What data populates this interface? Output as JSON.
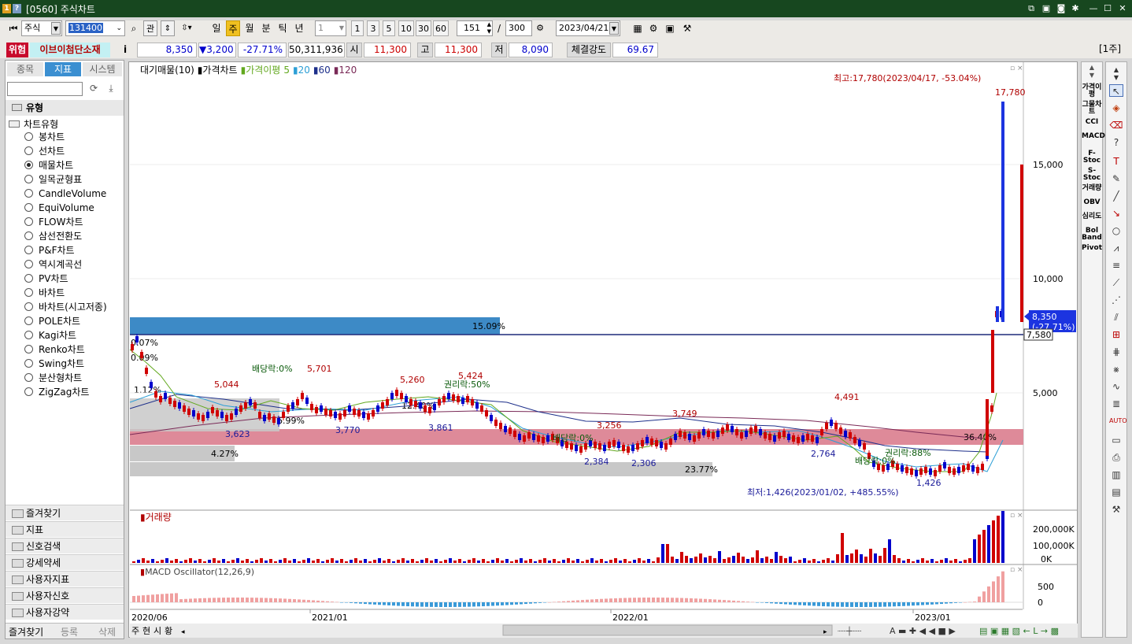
{
  "window": {
    "title": "[0560] 주식차트",
    "icons": [
      "window-icon",
      "help-icon"
    ]
  },
  "toolbar": {
    "market": "주식",
    "code": "131400",
    "btn_gwan": "관",
    "period_buttons": [
      "일",
      "주",
      "월",
      "분",
      "틱",
      "년"
    ],
    "active_period": "주",
    "interval_value": "1",
    "interval_buttons": [
      "1",
      "3",
      "5",
      "10",
      "30",
      "60"
    ],
    "count": "151",
    "total": "300",
    "date": "2023/04/21",
    "slash": "/"
  },
  "info": {
    "warning": "위험",
    "name": "이브이첨단소재",
    "i": "i",
    "price": "8,350",
    "change": "▼3,200",
    "change_pct": "-27.71%",
    "volume": "50,311,936",
    "open_label": "시",
    "open": "11,300",
    "high_label": "고",
    "high": "11,300",
    "low_label": "저",
    "low": "8,090",
    "strength_label": "체결강도",
    "strength": "69.67",
    "unit": "[1주]",
    "colors": {
      "down": "#0000cc",
      "up": "#cc0000"
    }
  },
  "left": {
    "tabs": [
      "종목",
      "지표",
      "시스템"
    ],
    "active_tab": "지표",
    "section": "유형",
    "group": "차트유형",
    "types": [
      "봉차트",
      "선차트",
      "매물차트",
      "일목균형표",
      "CandleVolume",
      "EquiVolume",
      "FLOW차트",
      "삼선전환도",
      "P&F차트",
      "역시계곡선",
      "PV차트",
      "바차트",
      "바차트(시고저종)",
      "POLE차트",
      "Kagi차트",
      "Renko차트",
      "Swing차트",
      "분산형차트",
      "ZigZag차트"
    ],
    "selected_type": "매물차트",
    "folders": [
      "즐겨찾기",
      "지표",
      "신호검색",
      "강세약세",
      "사용자지표",
      "사용자신호",
      "사용자강약"
    ],
    "bottom": [
      "즐겨찾기",
      "등록",
      "삭제"
    ]
  },
  "price_legend": {
    "a": "대기매물(10)",
    "b": "가격차트",
    "c": "가격이평",
    "n5": "5",
    "n20": "20",
    "n60": "60",
    "n120": "120"
  },
  "price_axis": [
    "15,000",
    "10,000",
    "5,000"
  ],
  "annotations": {
    "max": "최고:17,780(2023/04/17, -53.04%)",
    "min": "최저:1,426(2023/01/02, +485.55%)",
    "max_val": "17,780",
    "min_val": "1,426",
    "cur_price": "8,350",
    "cur_pct": "(-27.71%)",
    "line_val": "7,580",
    "div1": "배당락:0%",
    "div2": "배당락:0%",
    "div3": "배당락:0%",
    "rights1": "권리락:50%",
    "rights2": "권리락:88%",
    "h1": "5,044",
    "h2": "5,701",
    "h3": "5,260",
    "h4": "5,424",
    "h5": "3,256",
    "h6": "3,749",
    "h7": "4,491",
    "l1": "3,623",
    "l2": "3,770",
    "l3": "3,861",
    "l4": "2,384",
    "l5": "2,306",
    "l6": "2,764",
    "l7": "1,426",
    "vp1": "15.09%",
    "vp2": "36.40%",
    "vp3": "4.27%",
    "vp4": "23.77%",
    "vp5": "1.12%",
    "vp6": "6.99%",
    "vp7": "0.07%",
    "vp8": "0.09%",
    "vp9": "12.40%"
  },
  "volume": {
    "title": "거래량",
    "axis": [
      "200,000K",
      "100,000K",
      "0K"
    ]
  },
  "macd": {
    "title": "MACD Oscillator(12,26,9)",
    "axis": [
      "500",
      "0"
    ]
  },
  "xaxis": [
    "2020/06",
    "2021/01",
    "2022/01",
    "2023/01"
  ],
  "bottom_tabs": [
    "주",
    "현",
    "시",
    "황"
  ],
  "right_tools": [
    "가격이평",
    "그물차트",
    "CCI",
    "MACD",
    "F-Stoc",
    "S-Stoc",
    "거래량",
    "OBV",
    "심리도",
    "Bol Band",
    "Pivot"
  ]
}
